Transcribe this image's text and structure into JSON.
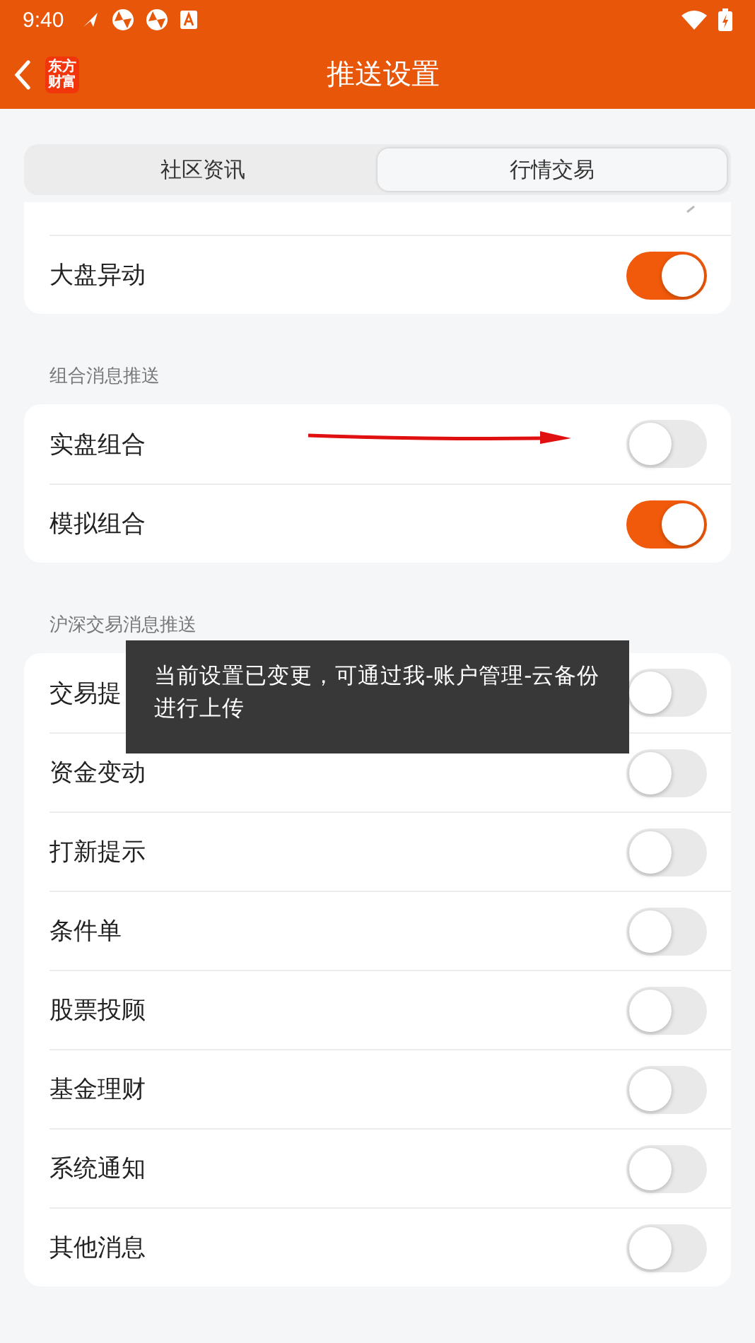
{
  "status_bar": {
    "time": "9:40"
  },
  "header": {
    "logo": [
      "东方",
      "财富"
    ],
    "title": "推送设置"
  },
  "tabs": [
    {
      "label": "社区资讯",
      "selected": false
    },
    {
      "label": "行情交易",
      "selected": true
    }
  ],
  "groups": [
    {
      "items": [
        {
          "label": "大盘异动",
          "on": true
        }
      ]
    },
    {
      "title": "组合消息推送",
      "items": [
        {
          "label": "实盘组合",
          "on": false
        },
        {
          "label": "模拟组合",
          "on": true
        }
      ]
    },
    {
      "title": "沪深交易消息推送",
      "items": [
        {
          "label": "交易提",
          "on": false
        },
        {
          "label": "资金变动",
          "on": false
        },
        {
          "label": "打新提示",
          "on": false
        },
        {
          "label": "条件单",
          "on": false
        },
        {
          "label": "股票投顾",
          "on": false
        },
        {
          "label": "基金理财",
          "on": false
        },
        {
          "label": "系统通知",
          "on": false
        },
        {
          "label": "其他消息",
          "on": false
        }
      ]
    }
  ],
  "toast": {
    "text": "当前设置已变更，可通过我-账户管理-云备份进行上传"
  }
}
